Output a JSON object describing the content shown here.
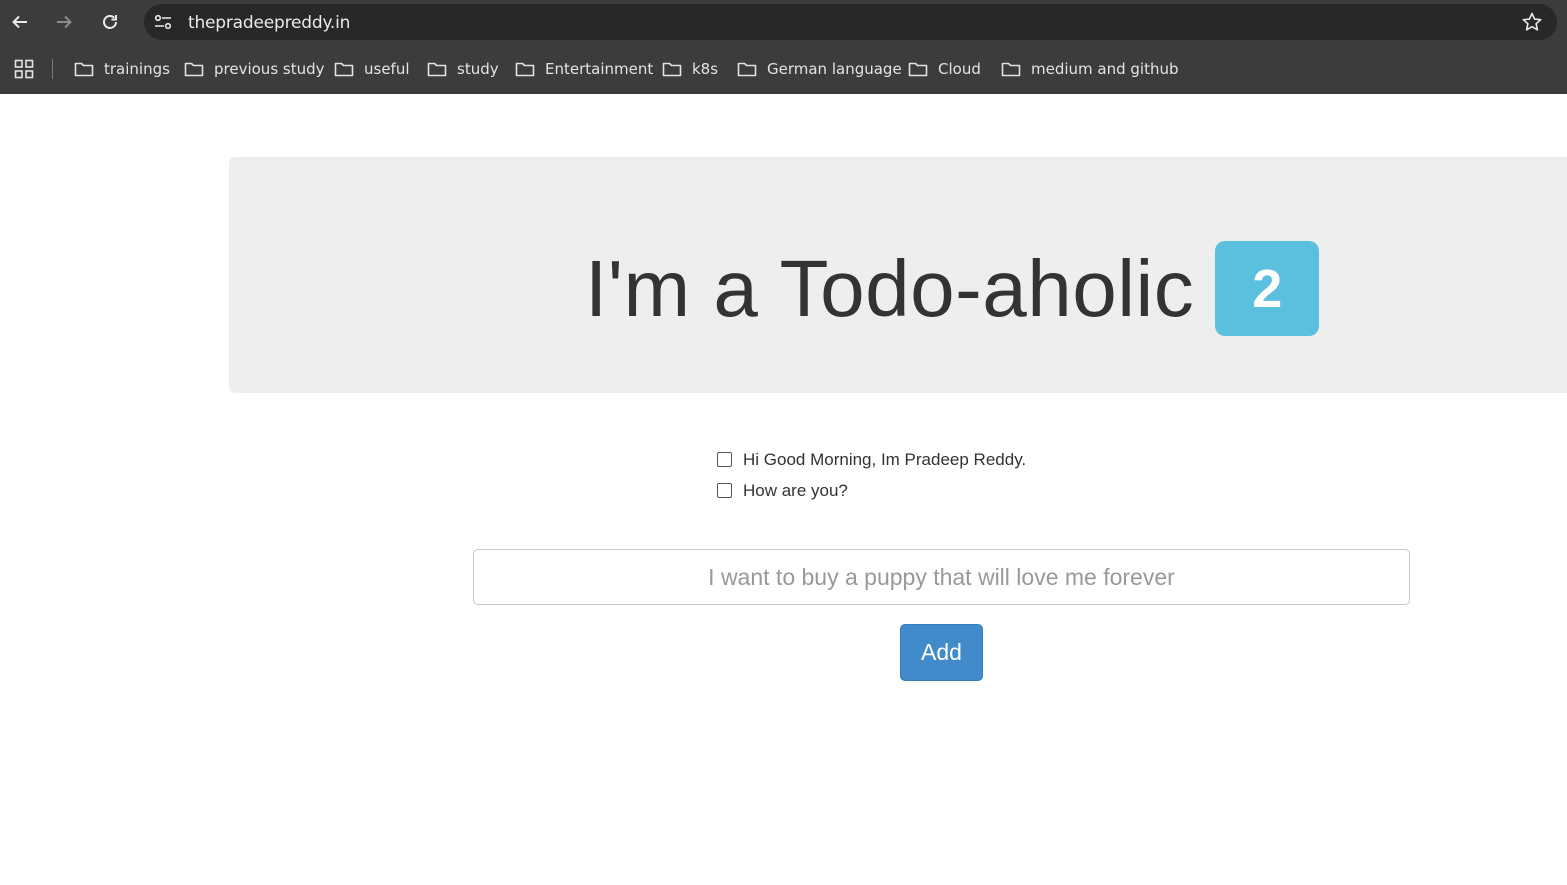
{
  "browser": {
    "url": "thepradeepreddy.in",
    "bookmarks": [
      "trainings",
      "previous study",
      "useful",
      "study",
      "Entertainment",
      "k8s",
      "German language",
      "Cloud",
      "medium and github"
    ]
  },
  "app": {
    "title": "I'm a Todo-aholic",
    "count": "2",
    "todos": [
      {
        "text": "Hi Good Morning, Im Pradeep Reddy.",
        "done": false
      },
      {
        "text": "How are you?",
        "done": false
      }
    ],
    "input_placeholder": "I want to buy a puppy that will love me forever",
    "input_value": "",
    "add_label": "Add"
  },
  "colors": {
    "badge": "#5bc0de",
    "button": "#428bca",
    "jumbotron": "#eeeeee",
    "chrome": "#3c3c3c"
  }
}
